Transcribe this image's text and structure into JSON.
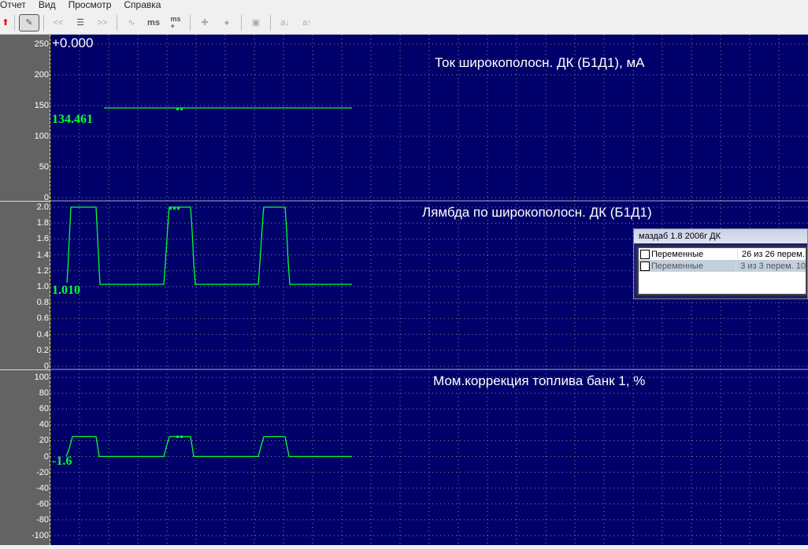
{
  "menu": [
    "Отчет",
    "Вид",
    "Просмотр",
    "Справка"
  ],
  "toolbar": {
    "prev": "<<",
    "next": ">>",
    "ms_minus": "ms",
    "ms_plus": "ms\n+",
    "a_down": "a↓",
    "a_up": "a↑"
  },
  "colors": {
    "plot_bg": "#00006a",
    "signal": "#00ff33",
    "axis_bg": "#636363"
  },
  "time_offset": "+0.000",
  "panels": [
    {
      "title": "Ток широкополосн. ДК (Б1Д1), мА",
      "value": "134.461",
      "ticks": [
        "250",
        "200",
        "150",
        "100",
        "50",
        "0"
      ],
      "range": [
        0,
        250
      ],
      "points": [
        [
          132,
          137
        ],
        [
          447,
          137
        ]
      ]
    },
    {
      "title": "Лямбда по  широкополосн. ДК (Б1Д1)",
      "value": "1.010",
      "ticks": [
        "2.0",
        "1.8",
        "1.6",
        "1.4",
        "1.2",
        "1.0",
        "0.8",
        "0.6",
        "0.4",
        "0.2",
        "0"
      ],
      "range": [
        0,
        2
      ],
      "points": [
        [
          85,
          1.05
        ],
        [
          86,
          1.2
        ],
        [
          87,
          1.4
        ],
        [
          88,
          1.6
        ],
        [
          89,
          1.8
        ],
        [
          90,
          2.0
        ],
        [
          122,
          2.0
        ],
        [
          123,
          1.8
        ],
        [
          124,
          1.6
        ],
        [
          125,
          1.4
        ],
        [
          126,
          1.2
        ],
        [
          127,
          1.03
        ],
        [
          208,
          1.03
        ],
        [
          210,
          1.3
        ],
        [
          212,
          1.6
        ],
        [
          214,
          1.9
        ],
        [
          215,
          2.0
        ],
        [
          242,
          2.0
        ],
        [
          244,
          1.7
        ],
        [
          246,
          1.3
        ],
        [
          248,
          1.03
        ],
        [
          328,
          1.03
        ],
        [
          330,
          1.3
        ],
        [
          332,
          1.6
        ],
        [
          334,
          1.9
        ],
        [
          335,
          2.0
        ],
        [
          362,
          2.0
        ],
        [
          364,
          1.7
        ],
        [
          366,
          1.3
        ],
        [
          368,
          1.03
        ],
        [
          447,
          1.03
        ]
      ]
    },
    {
      "title": "Мом.коррекция топлива банк 1, %",
      "value": "-1.6",
      "ticks": [
        "100",
        "80",
        "60",
        "40",
        "20",
        "0",
        "-20",
        "-40",
        "-60",
        "-80",
        "-100"
      ],
      "range": [
        -100,
        100
      ],
      "points": [
        [
          84,
          0
        ],
        [
          88,
          10
        ],
        [
          92,
          25
        ],
        [
          122,
          25
        ],
        [
          126,
          0
        ],
        [
          208,
          0
        ],
        [
          212,
          15
        ],
        [
          215,
          25
        ],
        [
          242,
          25
        ],
        [
          246,
          0
        ],
        [
          328,
          0
        ],
        [
          332,
          15
        ],
        [
          335,
          25
        ],
        [
          362,
          25
        ],
        [
          367,
          0
        ],
        [
          447,
          0
        ]
      ]
    }
  ],
  "window": {
    "title": "маздаб 1.8 2006г ДК",
    "rows": [
      {
        "name": "Переменные",
        "info": "26 из 26 перем."
      },
      {
        "name": "Переменные",
        "info": "3 из 3 перем. 10"
      }
    ]
  }
}
